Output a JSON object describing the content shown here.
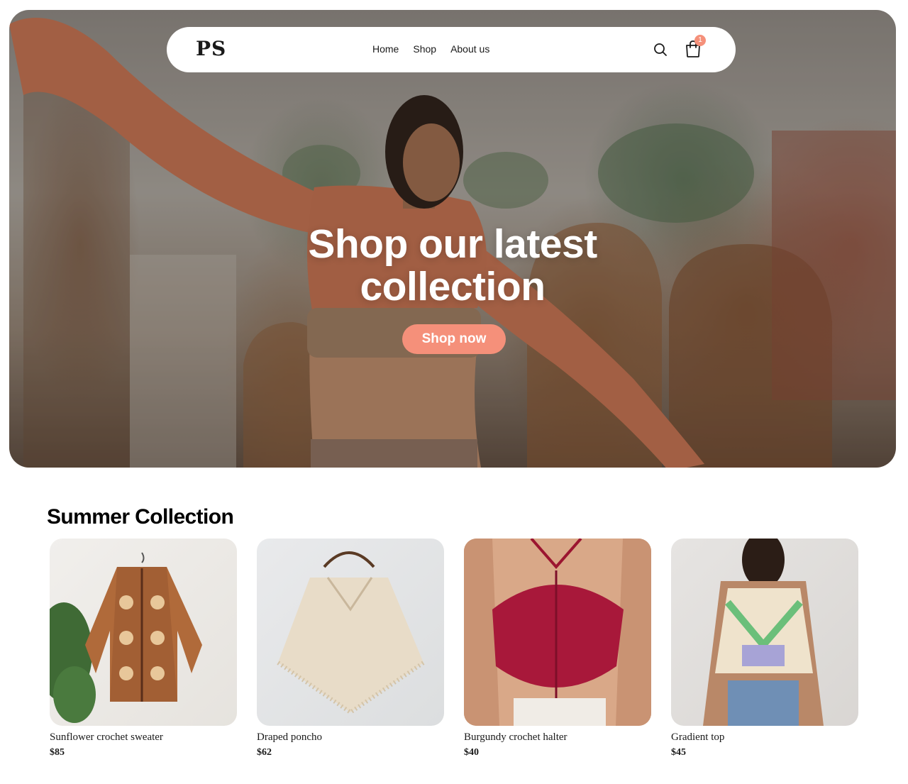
{
  "brand": {
    "logo": "PS"
  },
  "nav": {
    "links": [
      {
        "label": "Home"
      },
      {
        "label": "Shop"
      },
      {
        "label": "About us"
      }
    ],
    "cart_count": "1"
  },
  "hero": {
    "title_line1": "Shop our latest",
    "title_line2": "collection",
    "cta": "Shop now"
  },
  "collection": {
    "title": "Summer Collection",
    "products": [
      {
        "name": "Sunflower crochet sweater",
        "price": "$85"
      },
      {
        "name": "Draped poncho",
        "price": "$62"
      },
      {
        "name": "Burgundy crochet halter",
        "price": "$40"
      },
      {
        "name": "Gradient top",
        "price": "$45"
      }
    ]
  },
  "colors": {
    "accent": "#f5907a",
    "text": "#1a1a1a",
    "background": "#ffffff"
  }
}
